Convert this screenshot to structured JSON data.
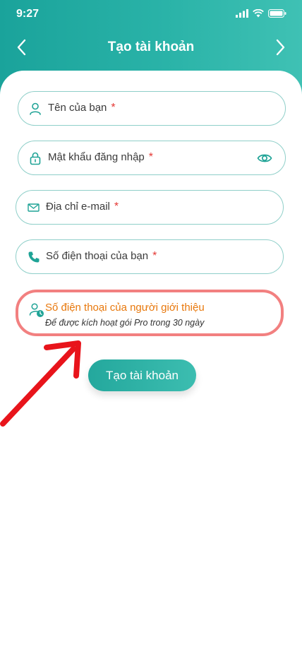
{
  "status": {
    "time": "9:27"
  },
  "header": {
    "title": "Tạo tài khoản"
  },
  "form": {
    "name_label": "Tên của bạn",
    "password_label": "Mật khẩu đăng nhập",
    "email_label": "Địa chỉ e-mail",
    "phone_label": "Số điện thoại của bạn",
    "required_mark": "*",
    "referral_label": "Số điện thoại của người giới thiệu",
    "referral_hint": "Để được kích hoạt gói Pro trong 30 ngày",
    "submit_label": "Tạo tài khoản"
  },
  "icons": {
    "back": "chevron-left-icon",
    "forward": "chevron-right-icon",
    "name": "user-icon",
    "password": "lock-icon",
    "show_password": "eye-icon",
    "email": "mail-icon",
    "phone": "phone-icon",
    "referral": "user-clock-icon"
  },
  "colors": {
    "header": "#2ab3a8",
    "field_border": "#8fcfc9",
    "required": "#e53935",
    "referral_text": "#e8780c",
    "highlight_border": "#f28080",
    "arrow": "#e8141b"
  }
}
